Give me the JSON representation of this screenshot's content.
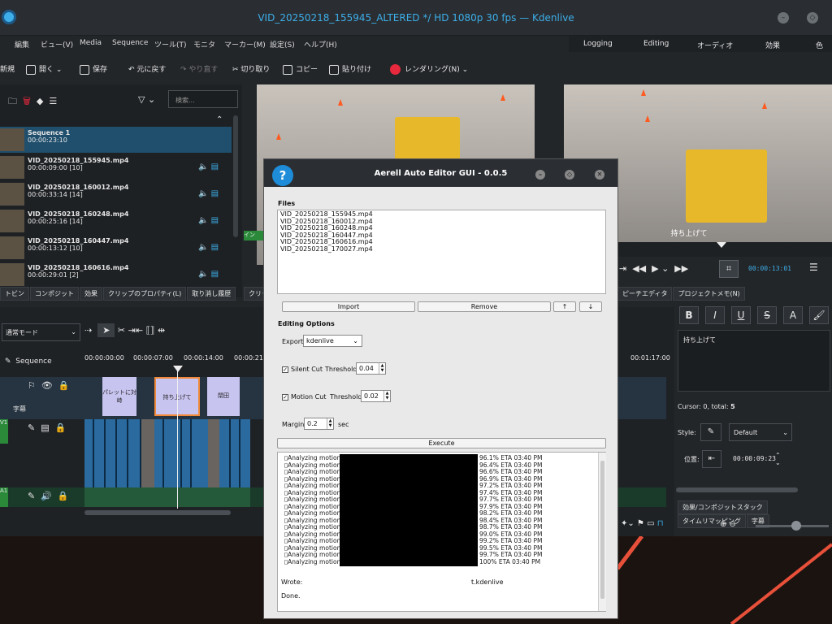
{
  "window": {
    "title": "VID_20250218_155945_ALTERED */ HD 1080p 30 fps — Kdenlive"
  },
  "menu": [
    "編集",
    "ビュー(V)",
    "Media",
    "Sequence",
    "ツール(T)",
    "モニタ",
    "マーカー(M)",
    "設定(S)",
    "ヘルプ(H)"
  ],
  "layouts": [
    "Logging",
    "Editing",
    "オーディオ",
    "効果",
    "色"
  ],
  "toolbar": {
    "new": "新規",
    "open": "開く",
    "save": "保存",
    "undo": "元に戻す",
    "redo": "やり直す",
    "cut": "切り取り",
    "copy": "コピー",
    "paste": "貼り付け",
    "render": "レンダリング(N)"
  },
  "bin": {
    "search_placeholder": "検索...",
    "clips": [
      {
        "name": "Sequence 1",
        "duration": "00:00:23:10"
      },
      {
        "name": "VID_20250218_155945.mp4",
        "duration": "00:00:09:00 [10]"
      },
      {
        "name": "VID_20250218_160012.mp4",
        "duration": "00:00:33:14 [14]"
      },
      {
        "name": "VID_20250218_160248.mp4",
        "duration": "00:00:25:16 [14]"
      },
      {
        "name": "VID_20250218_160447.mp4",
        "duration": "00:00:13:12 [10]"
      },
      {
        "name": "VID_20250218_160616.mp4",
        "duration": "00:00:29:01 [2]"
      }
    ],
    "tabs": [
      "トビン",
      "コンポジット",
      "効果",
      "クリップのプロパティ(L)",
      "取り消し履歴"
    ]
  },
  "monitor_tab": "クリッ",
  "project_monitor": {
    "timecode": "00:00:13:01",
    "subtitle": "持ち上げて"
  },
  "right_tabs": [
    "ピーチエディタ",
    "プロジェクトメモ(N)"
  ],
  "timeline": {
    "mode": "通常モード",
    "sequence_label": "Sequence",
    "ruler": [
      "00:00:00:00",
      "00:00:07:00",
      "00:00:14:00",
      "00:00:21",
      "00:01:17:00"
    ],
    "subtitle_track_label": "字幕",
    "subtitles": [
      "パレットに対峙",
      "持ち上げて",
      "閉田"
    ],
    "v_label": "V1",
    "a_label": "A1"
  },
  "subtitle_panel": {
    "text": "持ち上げて",
    "cursor_info": "Cursor: 0, total: ",
    "total": "5",
    "style_label": "Style:",
    "style_value": "Default",
    "pos_label": "位置:",
    "pos_time": "00:00:09:23",
    "tabs": [
      "効果/コンポジットスタック",
      "タイムリマッピング",
      "字幕"
    ]
  },
  "dialog": {
    "title": "Aerell Auto Editor GUI - 0.0.5",
    "files_label": "Files",
    "files": [
      "VID_20250218_155945.mp4",
      "VID_20250218_160012.mp4",
      "VID_20250218_160248.mp4",
      "VID_20250218_160447.mp4",
      "VID_20250218_160616.mp4",
      "VID_20250218_170027.mp4"
    ],
    "import_label": "Import",
    "remove_label": "Remove",
    "up_label": "↑",
    "down_label": "↓",
    "editing_options_label": "Editing Options",
    "export_label": "Export",
    "export_value": "kdenlive",
    "silent_cut_label": "Silent Cut",
    "silent_threshold_label": "Threshold",
    "silent_threshold": "0.04",
    "motion_cut_label": "Motion Cut",
    "motion_threshold_label": "Threshold",
    "motion_threshold": "0.02",
    "margin_label": "Margin",
    "margin_value": "0.2",
    "margin_unit": "sec",
    "execute_label": "Execute",
    "log_prefix": "Analyzing motion",
    "log_progress": [
      "96.1%  ETA 03:40 PM",
      "96.4%  ETA 03:40 PM",
      "96.6%  ETA 03:40 PM",
      "96.9%  ETA 03:40 PM",
      "97.2%  ETA 03:40 PM",
      "97.4%  ETA 03:40 PM",
      "97.7%  ETA 03:40 PM",
      "97.9%  ETA 03:40 PM",
      "98.2%  ETA 03:40 PM",
      "98.4%  ETA 03:40 PM",
      "98.7%  ETA 03:40 PM",
      "99.0%  ETA 03:40 PM",
      "99.2%  ETA 03:40 PM",
      "99.5%  ETA 03:40 PM",
      "99.7%  ETA 03:40 PM",
      "100%  ETA 03:40 PM"
    ],
    "wrote_label": "Wrote:",
    "wrote_value": "t.kdenlive",
    "done_label": "Done."
  }
}
